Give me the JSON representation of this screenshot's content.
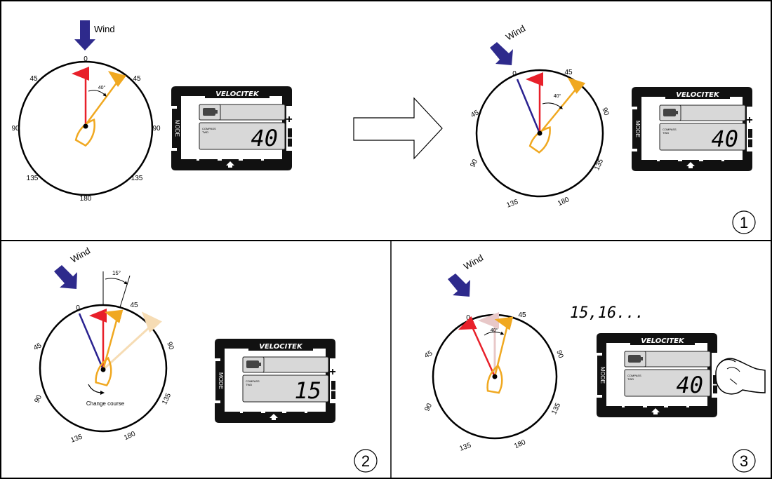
{
  "colors": {
    "wind_arrow": "#2e2a8c",
    "heading_red": "#e8202a",
    "boat_orange": "#f0a820",
    "wind_line_blue": "#2a2290",
    "faded_orange": "#f6dcb4",
    "faded_pink": "#e8c8c8",
    "lcd_screen": "#d8d8d8",
    "device_black": "#111111"
  },
  "icons": [
    "wind-arrow-icon",
    "boat-icon",
    "battery-icon",
    "up-arrow-icon",
    "hand-pressing-icon",
    "right-arrow-icon"
  ],
  "panel_top": {
    "wind_label": "Wind",
    "angle_label": "40°",
    "compass_labels": [
      "0",
      "45",
      "90",
      "135",
      "180",
      "135",
      "90",
      "45"
    ],
    "device": {
      "brand": "VELOCITEK",
      "mode": "MODE",
      "lcd_small": "COMPASS\nTWD",
      "reading": "40",
      "plus": "+",
      "minus": "−"
    },
    "rotated": {
      "wind_label": "Wind",
      "angle_label": "40°",
      "compass_labels": [
        "0",
        "45",
        "90",
        "135",
        "180",
        "90",
        "45"
      ],
      "device": {
        "brand": "VELOCITEK",
        "mode": "MODE",
        "lcd_small": "COMPASS\nTWD",
        "reading": "40",
        "plus": "+",
        "minus": "−"
      }
    },
    "step": "1"
  },
  "panel_2": {
    "wind_label": "Wind",
    "angle_label": "15°",
    "compass_labels": [
      "0",
      "45",
      "90",
      "135",
      "180",
      "135",
      "90",
      "45"
    ],
    "change_course": "Change course",
    "device": {
      "brand": "VELOCITEK",
      "mode": "MODE",
      "lcd_small": "COMPASS\nTWD",
      "reading": "15",
      "plus": "+",
      "minus": "−"
    },
    "step": "2"
  },
  "panel_3": {
    "wind_label": "Wind",
    "angle_label": "40°",
    "compass_labels": [
      "0",
      "45",
      "90",
      "135",
      "180",
      "135",
      "90",
      "45"
    ],
    "counting": "15,16...",
    "device": {
      "brand": "VELOCITEK",
      "mode": "MODE",
      "lcd_small": "COMPASS\nTWD",
      "reading": "40",
      "plus": "+",
      "minus": "−"
    },
    "step": "3"
  }
}
